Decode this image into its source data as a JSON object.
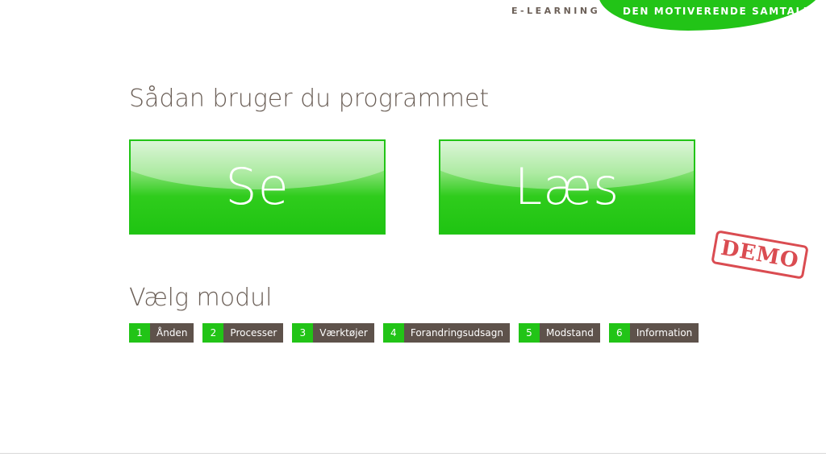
{
  "header": {
    "elearning_label": "E-LEARNING",
    "brand_label": "DEN MOTIVERENDE SAMTALE"
  },
  "intro": {
    "title": "Sådan bruger du programmet",
    "see_label": "Se",
    "read_label": "Læs"
  },
  "stamp": {
    "label": "DEMO"
  },
  "modules_section": {
    "title": "Vælg modul",
    "items": [
      {
        "num": "1",
        "label": "Ånden"
      },
      {
        "num": "2",
        "label": "Processer"
      },
      {
        "num": "3",
        "label": "Værktøjer"
      },
      {
        "num": "4",
        "label": "Forandringsudsagn"
      },
      {
        "num": "5",
        "label": "Modstand"
      },
      {
        "num": "6",
        "label": "Information"
      }
    ]
  },
  "colors": {
    "accent_green": "#22c417",
    "module_brown": "#5e524b",
    "text_brown": "#6b5f57",
    "stamp_red": "#d6393f"
  }
}
